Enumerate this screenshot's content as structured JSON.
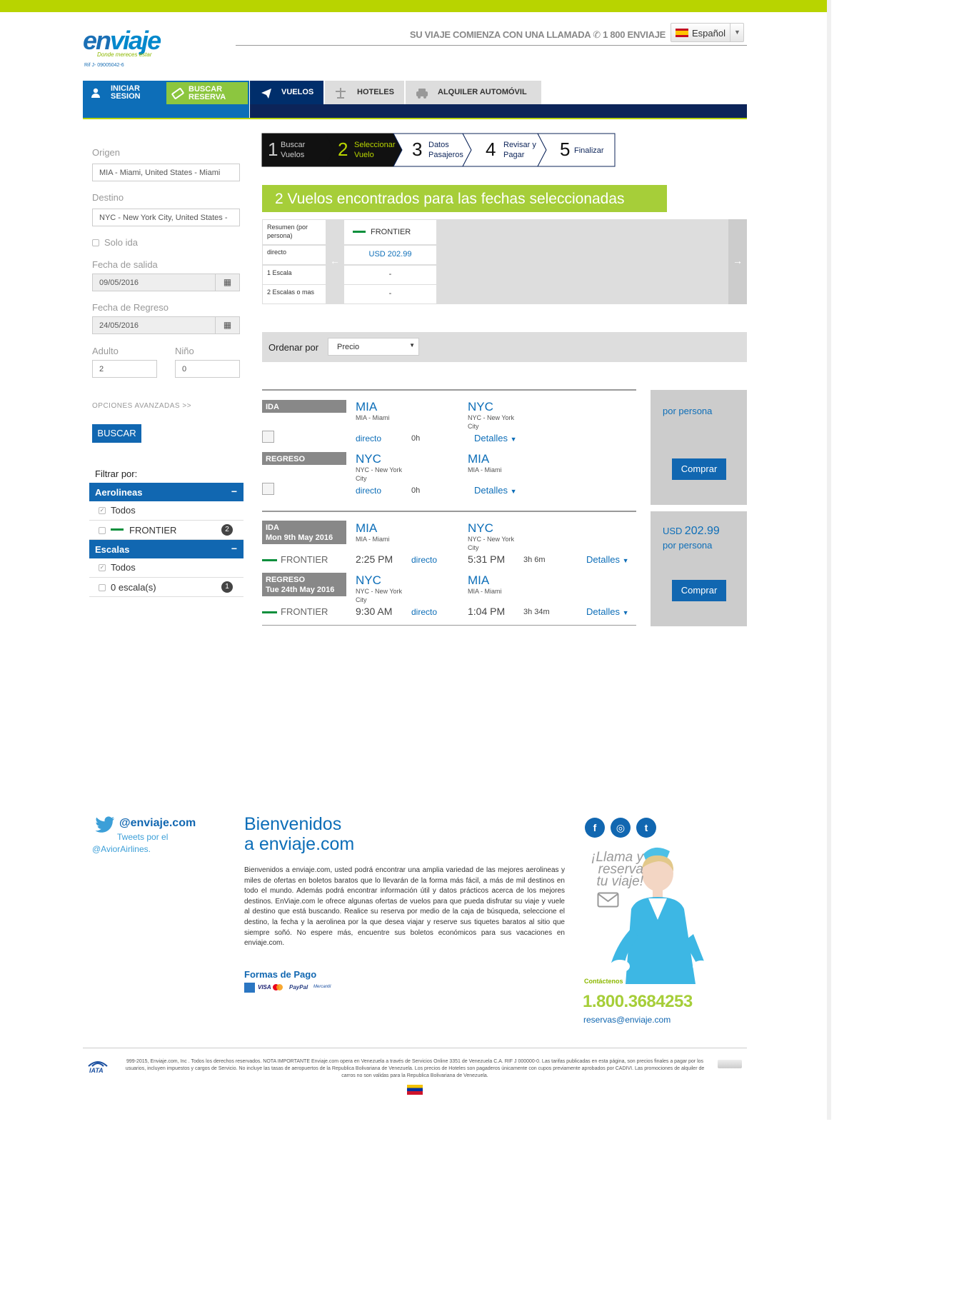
{
  "header": {
    "logo_text_1": "en",
    "logo_text_2": "viaje",
    "logo_tagline": "Donde mereces estar",
    "logo_rif": "Rif J- 09005042-6",
    "slogan": "SU VIAJE COMIENZA CON UNA LLAMADA",
    "slogan_phone": "1 800 ENVIAJE",
    "language": "Español"
  },
  "nav": {
    "login_1": "INICIAR",
    "login_2": "SESION",
    "buscar_1": "BUSCAR",
    "buscar_2": "RESERVA",
    "vuelos": "VUELOS",
    "hoteles": "HOTELES",
    "auto": "ALQUILER AUTOMÓVIL"
  },
  "search": {
    "origen_label": "Origen",
    "origen_value": "MIA - Miami, United States - Miami",
    "destino_label": "Destino",
    "destino_value": "NYC - New York City, United States - ",
    "solo_ida": "Solo ida",
    "salida_label": "Fecha de salida",
    "salida_value": "09/05/2016",
    "regreso_label": "Fecha de Regreso",
    "regreso_value": "24/05/2016",
    "adulto_label": "Adulto",
    "adulto_value": "2",
    "nino_label": "Niño",
    "nino_value": "0",
    "avanzadas": "OPCIONES AVANZADAS >>",
    "buscar_button": "BUSCAR"
  },
  "filters": {
    "title": "Filtrar por:",
    "aerolineas_head": "Aerolineas",
    "aerolineas_todos": "Todos",
    "aerolinea_name": "FRONTIER",
    "aerolinea_count": "2",
    "escalas_head": "Escalas",
    "escalas_todos": "Todos",
    "escala_0": "0 escala(s)",
    "escala_0_count": "1",
    "minus": "−"
  },
  "steps": [
    {
      "num": "1",
      "l1": "Buscar",
      "l2": "Vuelos"
    },
    {
      "num": "2",
      "l1": "Seleccionar",
      "l2": "Vuelo"
    },
    {
      "num": "3",
      "l1": "Datos",
      "l2": "Pasajeros"
    },
    {
      "num": "4",
      "l1": "Revisar y",
      "l2": "Pagar"
    },
    {
      "num": "5",
      "l1": "Finalizar",
      "l2": ""
    }
  ],
  "banner": "2 Vuelos encontrados para las fechas seleccionadas",
  "matrix": {
    "row_summary": "Resumen (por persona)",
    "row_directo": "directo",
    "row_1escala": "1 Escala",
    "row_2escalas": "2 Escalas o mas",
    "airline": "FRONTIER",
    "price_directo": "USD 202.99",
    "dash1": "-",
    "dash2": "-"
  },
  "sort": {
    "label": "Ordenar por",
    "value": "Precio"
  },
  "results": [
    {
      "ida_chip": "IDA",
      "ida_date": "",
      "ida_from_code": "MIA",
      "ida_from_city": "MIA - Miami",
      "ida_to_code": "NYC",
      "ida_to_city": "NYC - New York City",
      "ida_airline": "",
      "ida_dep": "",
      "ida_stops": "directo",
      "ida_arr": "",
      "ida_dur": "0h",
      "regreso_chip": "REGRESO",
      "regreso_date": "",
      "reg_from_code": "NYC",
      "reg_from_city": "NYC - New York City",
      "reg_to_code": "MIA",
      "reg_to_city": "MIA - Miami",
      "reg_stops": "directo",
      "reg_dur": "0h",
      "detalles": "Detalles",
      "price": "",
      "per_person": "por persona",
      "buy": "Comprar"
    },
    {
      "ida_chip": "IDA",
      "ida_date": "Mon 9th May 2016",
      "ida_from_code": "MIA",
      "ida_from_city": "MIA - Miami",
      "ida_to_code": "NYC",
      "ida_to_city": "NYC - New York City",
      "ida_airline": "FRONTIER",
      "ida_dep": "2:25 PM",
      "ida_stops": "directo",
      "ida_arr": "5:31 PM",
      "ida_dur": "3h 6m",
      "regreso_chip": "REGRESO",
      "regreso_date": "Tue 24th May 2016",
      "reg_from_code": "NYC",
      "reg_from_city": "NYC - New York City",
      "reg_to_code": "MIA",
      "reg_to_city": "MIA - Miami",
      "reg_airline": "FRONTIER",
      "reg_dep": "9:30 AM",
      "reg_stops": "directo",
      "reg_arr": "1:04 PM",
      "reg_dur": "3h 34m",
      "detalles": "Detalles",
      "price_cur": "USD",
      "price": "202.99",
      "per_person": "por persona",
      "buy": "Comprar"
    }
  ],
  "footer": {
    "twitter_handle": "@enviaje.com",
    "tweets_by": "Tweets por el",
    "tweets_account": "@AviorAirlines.",
    "welcome_1": "Bienvenidos",
    "welcome_2": "a enviaje.com",
    "paragraph": "Bienvenidos a enviaje.com, usted podrá encontrar una amplia variedad de las mejores aerolineas y miles de ofertas en boletos baratos que lo llevarán de la forma más fácil, a más de mil destinos en todo el mundo. Además podrá encontrar información útil y datos prácticos acerca de los mejores destinos. EnViaje.com le ofrece algunas ofertas de vuelos para que pueda disfrutar su viaje y vuele al destino que está buscando. Realice su reserva por medio de la caja de búsqueda, seleccione el destino, la fecha y la aerolinea por la que desea viajar y reserve sus tiquetes baratos al sitio que siempre soñó. No espere más, encuentre sus boletos económicos para sus vacaciones en enviaje.com.",
    "formas_pago": "Formas de Pago",
    "pay_visa": "VISA",
    "pay_paypal": "PayPal",
    "pay_mercantil": "Mercantil",
    "llama_1": "¡Llama y",
    "llama_2": "reserva",
    "llama_3": "tu viaje!",
    "contactenos": "Contáctenos",
    "phone": "1.800.3684253",
    "email": "reservas@enviaje.com",
    "iata": "IATA",
    "legal": "999-2015, Enviaje.com, Inc . Todos los derechos reservados. NOTA IMPORTANTE Enviaje.com opera en Venezuela a través de Servicios Online 3351 de Venezuela C.A. RIF J 000000-0. Las tarifas publicadas en esta página, son precios finales a pagar por los usuarios, incluyen impuestos y cargos de Servicio. No incluye las tasas de aeropuertos de la Republica Bolivariana de Venezuela. Los precios de Hoteles son pagaderos únicamente con cupos previamente aprobados por CADIVI. Las promociones de alquiler de carros no son validas para la Republica Bolivariana de Venezuela."
  },
  "colors": {
    "brand_blue": "#1167b1",
    "brand_green": "#a6ce39",
    "nav_dark": "#0c2459"
  },
  "icons": [
    "user-icon",
    "ticket-icon",
    "plane-icon",
    "hotel-icon",
    "car-icon",
    "calendar-icon",
    "chevron-down-icon",
    "arrow-left-icon",
    "arrow-right-icon",
    "twitter-icon",
    "facebook-icon",
    "instagram-icon",
    "mail-icon",
    "phone-icon",
    "broken-image-icon"
  ]
}
